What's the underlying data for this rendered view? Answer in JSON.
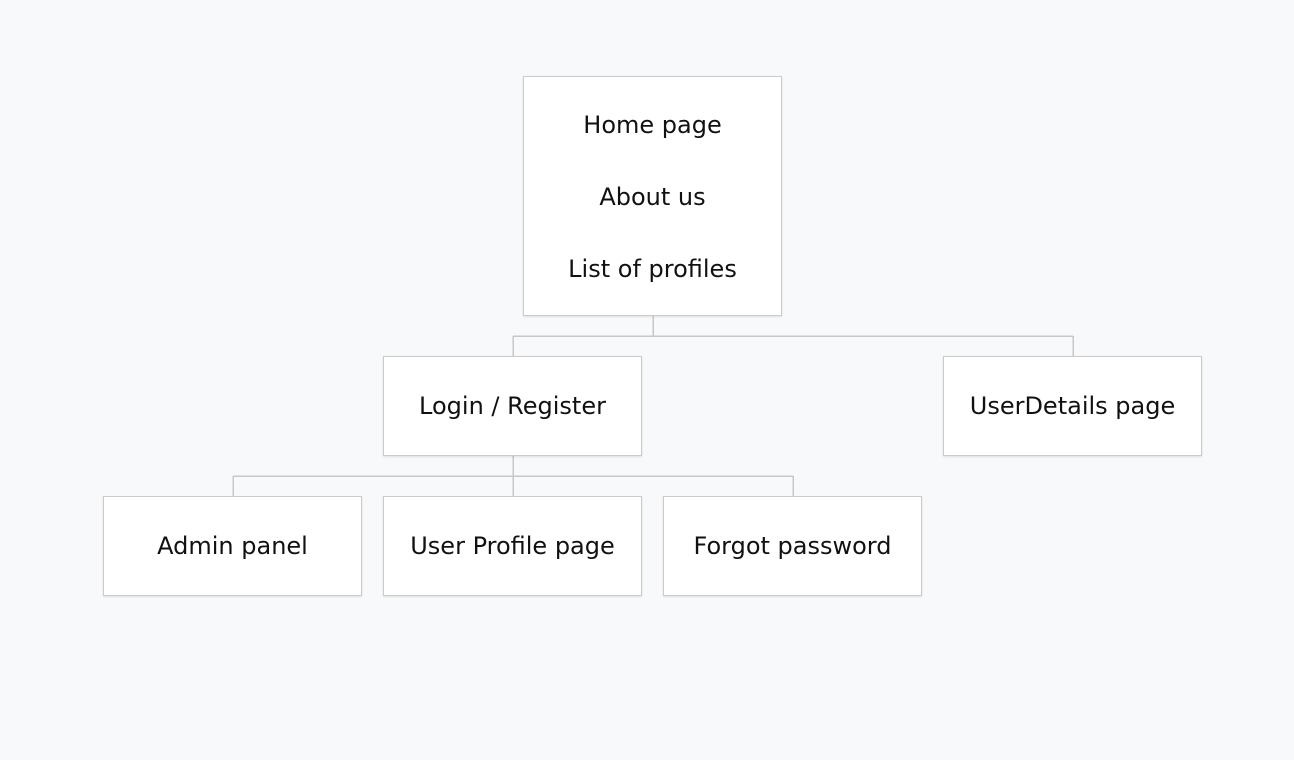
{
  "diagram": {
    "root": {
      "lines": [
        "Home page",
        "About us",
        "List of profiles"
      ]
    },
    "children": {
      "login": "Login / Register",
      "userdetails": "UserDetails page"
    },
    "grandchildren": {
      "admin": "Admin panel",
      "userprofile": "User Profile page",
      "forgot": "Forgot password"
    }
  },
  "colors": {
    "background": "#f8f9fa",
    "node_fill": "#ffffff",
    "node_border": "#cbcbcb",
    "connector": "#c8c8c8",
    "text": "#111111"
  }
}
